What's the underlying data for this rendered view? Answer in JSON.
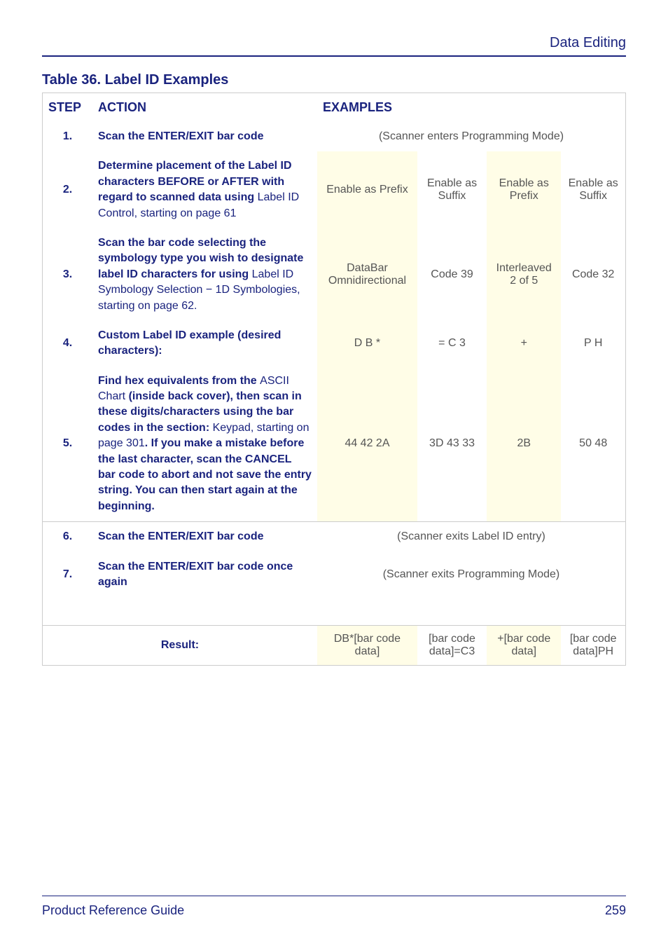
{
  "header": {
    "section": "Data Editing"
  },
  "title": "Table 36. Label ID Examples",
  "columns": {
    "step": "STEP",
    "action": "ACTION",
    "examples": "EXAMPLES"
  },
  "rows": [
    {
      "num": "1.",
      "action_html": "Scan the ENTER/EXIT bar code",
      "merged": "(Scanner enters Programming Mode)"
    },
    {
      "num": "2.",
      "action_html": "Determine placement of the Label ID characters BEFORE or AFTER with regard to scanned data using <span class='plain-link'>Label ID Control, starting on page 61</span>",
      "cells": [
        {
          "text": "Enable as Prefix",
          "hl": true
        },
        {
          "text": "Enable as Suffix",
          "hl": false
        },
        {
          "text": "Enable as Prefix",
          "hl": true
        },
        {
          "text": "Enable as Suffix",
          "hl": false
        }
      ]
    },
    {
      "num": "3.",
      "action_html": "Scan the bar code selecting the symbology type you wish to designate label ID characters for using <span class='plain-link'>Label ID Symbology Selection − 1D Symbologies, starting on page 62.</span>",
      "cells": [
        {
          "text": "DataBar Omnidirectional",
          "hl": true
        },
        {
          "text": "Code 39",
          "hl": false
        },
        {
          "text": "Interleaved 2 of 5",
          "hl": true
        },
        {
          "text": "Code 32",
          "hl": false
        }
      ]
    },
    {
      "num": "4.",
      "action_html": "Custom Label ID example (desired characters):",
      "cells": [
        {
          "text": "D  B  *",
          "hl": true
        },
        {
          "text": "= C 3",
          "hl": false
        },
        {
          "text": "+",
          "hl": true
        },
        {
          "text": "P H",
          "hl": false
        }
      ]
    },
    {
      "num": "5.",
      "action_html": "Find hex equivalents from the <span class='plain-link'>ASCII Chart</span> (inside back cover), then scan in these digits/characters using the bar codes in the section: <span class='plain-link'>Keypad, starting on page 301</span>. If you make a mistake before the last character, scan the CANCEL bar code to abort and not save the entry string. You can then start again at the beginning.",
      "cells": [
        {
          "text": "44 42 2A",
          "hl": true
        },
        {
          "text": "3D 43 33",
          "hl": false
        },
        {
          "text": "2B",
          "hl": true
        },
        {
          "text": "50 48",
          "hl": false
        }
      ]
    },
    {
      "num": "6.",
      "action_html": "Scan the ENTER/EXIT bar code",
      "merged": "(Scanner exits Label ID entry)"
    },
    {
      "num": "7.",
      "action_html": "Scan the ENTER/EXIT bar code once again",
      "merged": "(Scanner exits Programming Mode)"
    }
  ],
  "result": {
    "label": "Result:",
    "cells": [
      {
        "text": "DB*[bar code data]",
        "hl": true
      },
      {
        "text": "[bar code data]=C3",
        "hl": false
      },
      {
        "text": "+[bar code data]",
        "hl": true
      },
      {
        "text": "[bar code data]PH",
        "hl": false
      }
    ]
  },
  "footer": {
    "left": "Product Reference Guide",
    "right": "259"
  }
}
